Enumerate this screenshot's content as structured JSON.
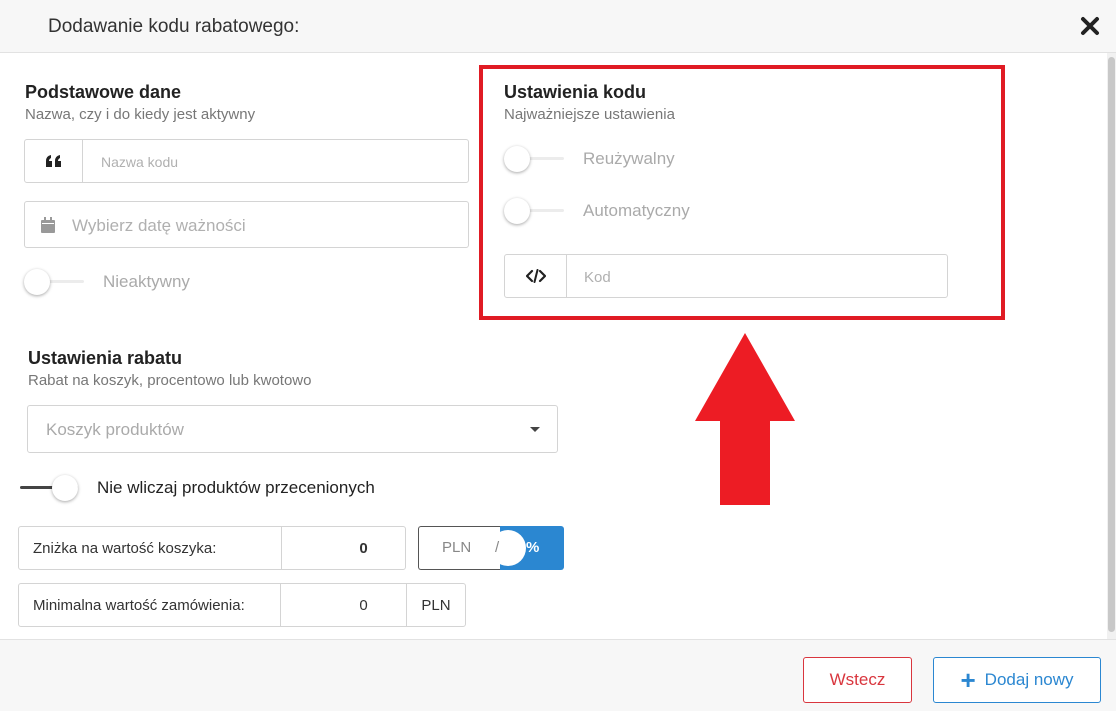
{
  "modal": {
    "title": "Dodawanie kodu rabatowego:"
  },
  "basic": {
    "title": "Podstawowe dane",
    "subtitle": "Nazwa, czy i do kiedy jest aktywny",
    "name_placeholder": "Nazwa kodu",
    "date_placeholder": "Wybierz datę ważności",
    "active_toggle": {
      "label": "Nieaktywny",
      "on": false
    }
  },
  "code_settings": {
    "title": "Ustawienia kodu",
    "subtitle": "Najważniejsze ustawienia",
    "reusable": {
      "label": "Reużywalny",
      "on": false
    },
    "automatic": {
      "label": "Automatyczny",
      "on": false
    },
    "code_placeholder": "Kod"
  },
  "discount": {
    "title": "Ustawienia rabatu",
    "subtitle": "Rabat na koszyk, procentowo lub kwotowo",
    "type_selected": "Koszyk produktów",
    "exclude_discounted": {
      "label": "Nie wliczaj produktów przecenionych",
      "on": true
    },
    "cart_discount": {
      "label": "Zniżka na wartość koszyka:",
      "value": "0"
    },
    "unit_toggle": {
      "left": "PLN",
      "separator": "/",
      "right": "%",
      "selected": "%"
    },
    "min_order": {
      "label": "Minimalna wartość zamówienia:",
      "value": "0",
      "unit": "PLN"
    }
  },
  "footer": {
    "back_label": "Wstecz",
    "add_icon": "+",
    "add_label": "Dodaj nowy"
  },
  "colors": {
    "highlight": "#e01b24",
    "primary": "#2b87d1",
    "danger": "#d9363e"
  },
  "icons": [
    "close-icon",
    "quote-icon",
    "calendar-icon",
    "code-icon",
    "caret-down-icon",
    "plus-icon",
    "up-arrow-annotation"
  ]
}
